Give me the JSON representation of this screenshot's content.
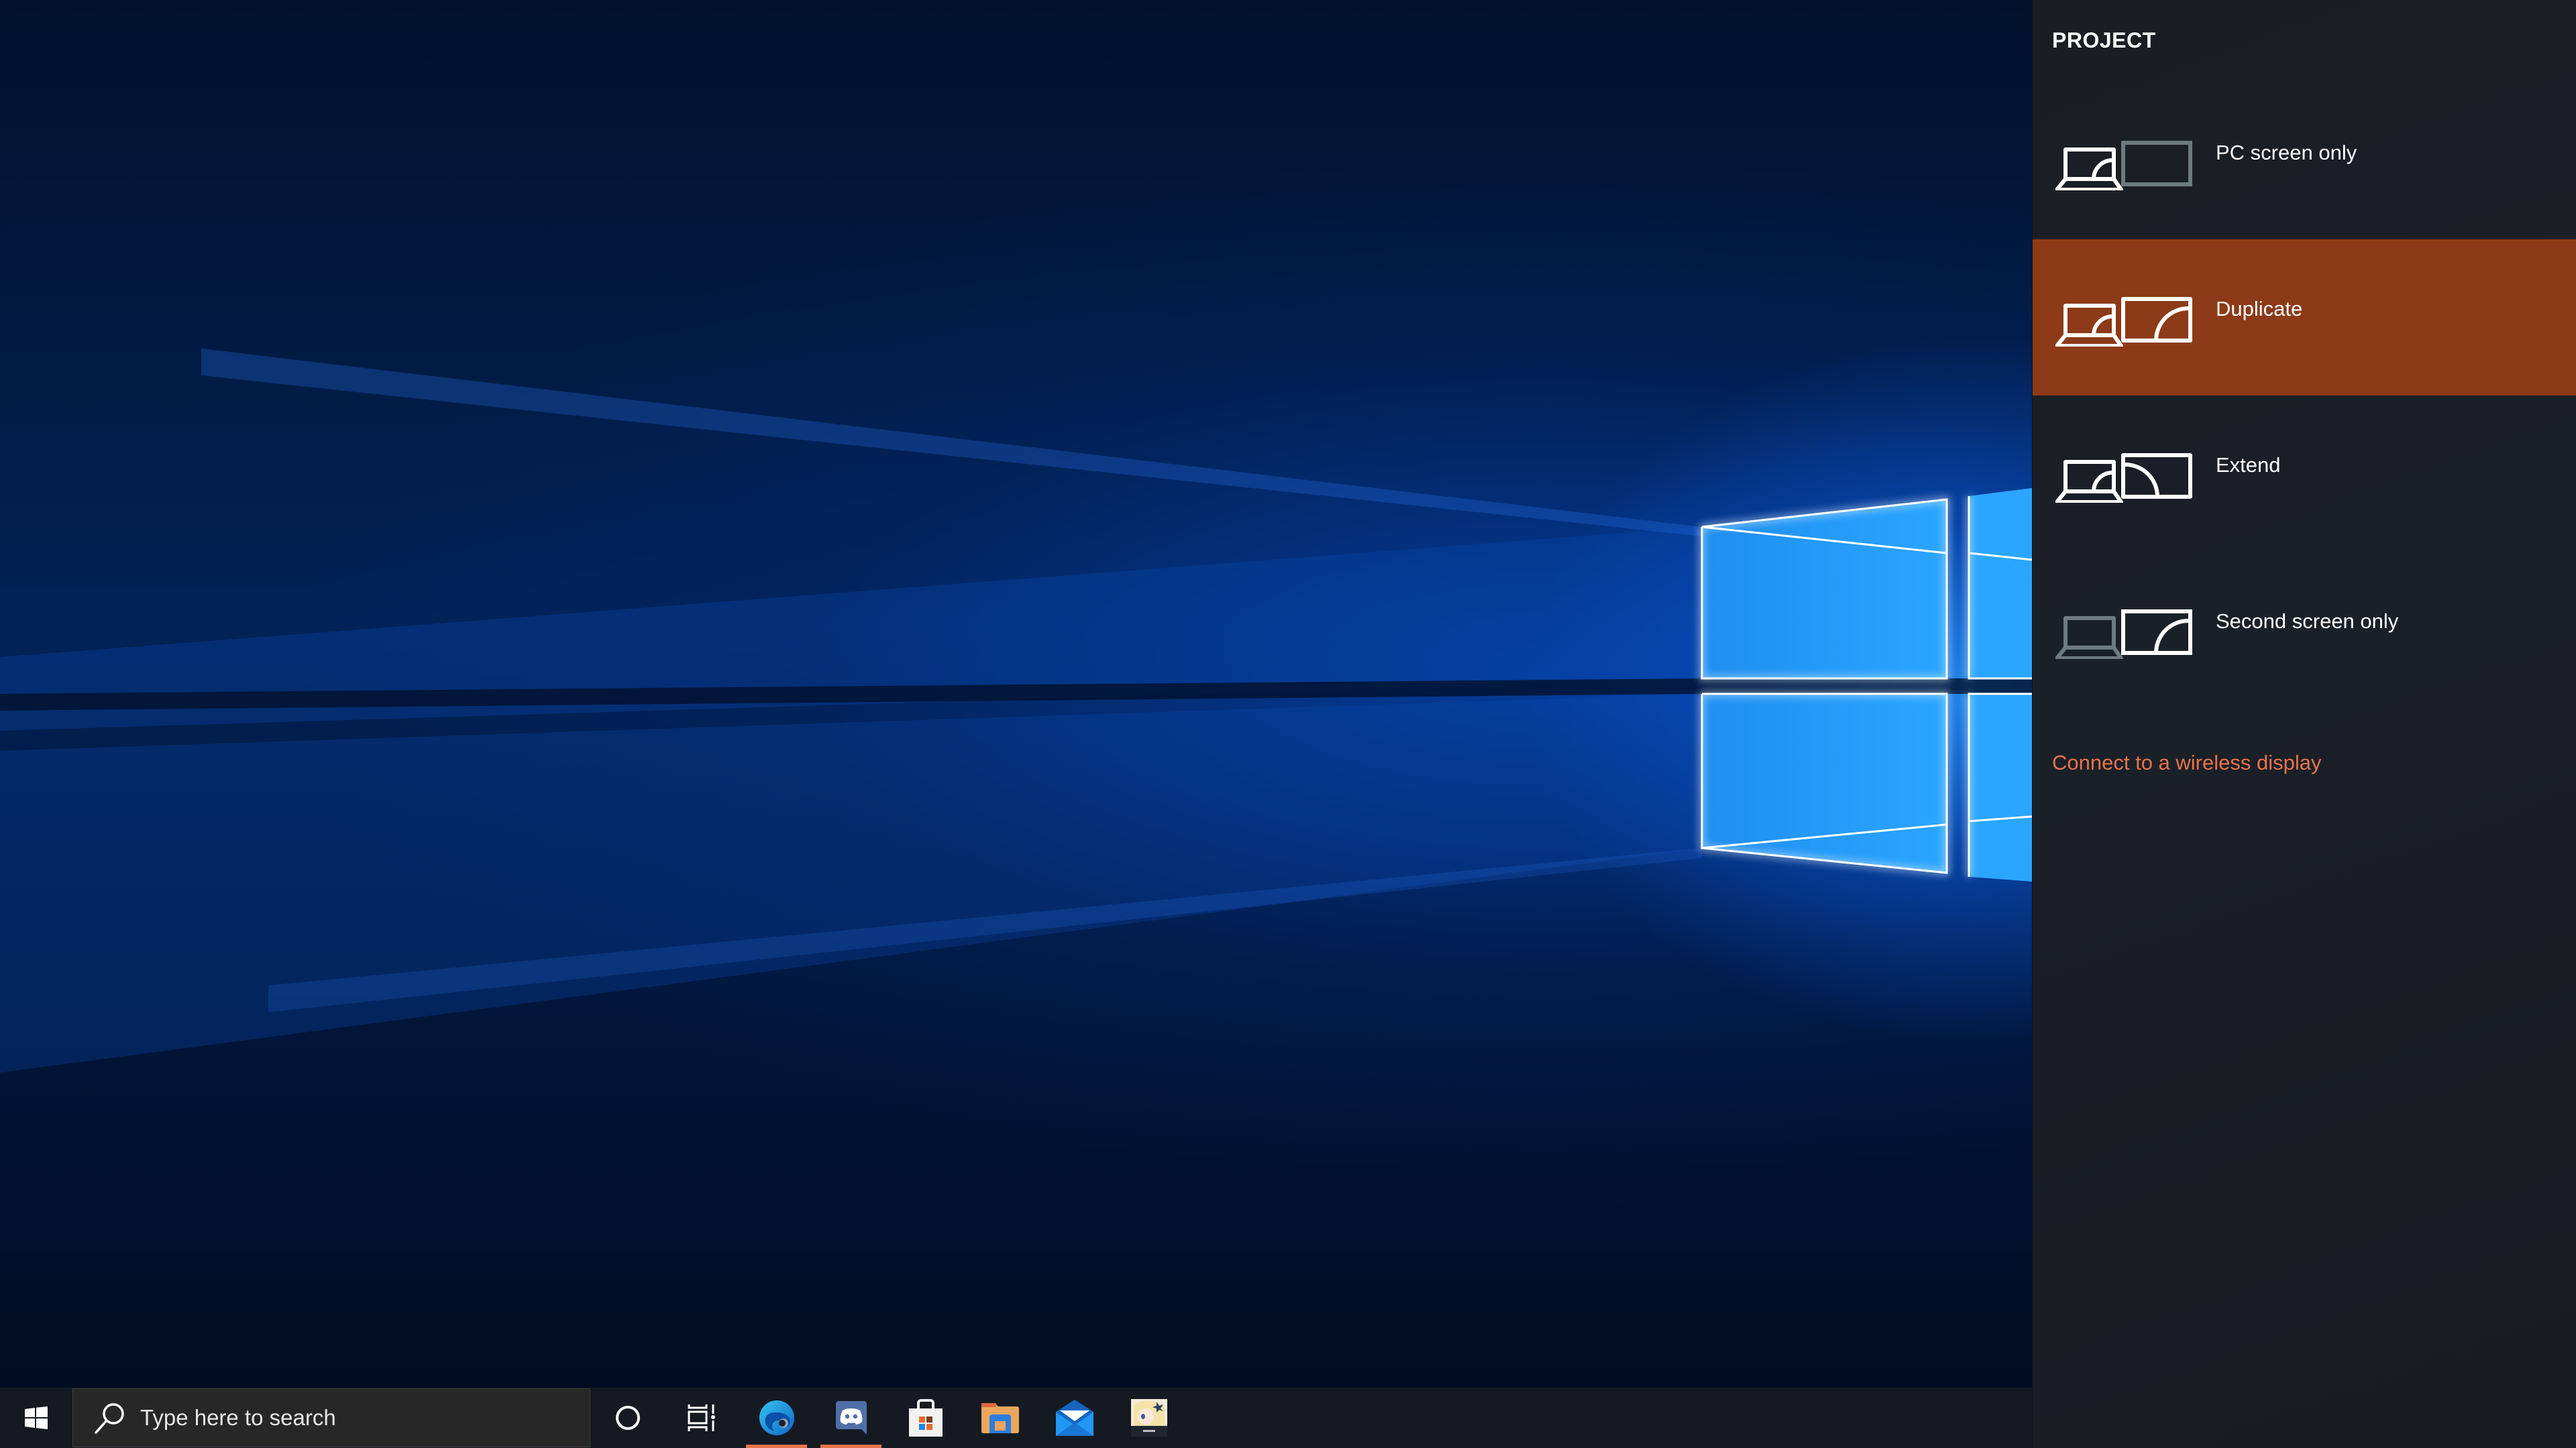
{
  "desktop": {
    "wallpaper": "Windows 10 hero wallpaper (blue light window)"
  },
  "taskbar": {
    "start_icon": "windows-logo-icon",
    "search": {
      "placeholder": "Type here to search",
      "icon": "search-icon"
    },
    "buttons": [
      {
        "name": "cortana",
        "icon": "cortana-circle-icon",
        "running": false
      },
      {
        "name": "task-view",
        "icon": "task-view-icon",
        "running": false
      },
      {
        "name": "microsoft-edge",
        "icon": "edge-icon",
        "running": true
      },
      {
        "name": "discord",
        "icon": "discord-icon",
        "running": true
      },
      {
        "name": "microsoft-store",
        "icon": "store-bag-icon",
        "running": false
      },
      {
        "name": "file-explorer",
        "icon": "folder-icon",
        "running": false
      },
      {
        "name": "mail",
        "icon": "mail-envelope-icon",
        "running": false
      },
      {
        "name": "app-shortcut",
        "icon": "anime-character-app-icon",
        "running": false
      }
    ],
    "indicator_color": "#e8734a"
  },
  "project_panel": {
    "title": "PROJECT",
    "accent_color": "#8c3a17",
    "items": [
      {
        "label": "PC screen only",
        "icon": "pc-screen-only-icon",
        "selected": false
      },
      {
        "label": "Duplicate",
        "icon": "duplicate-icon",
        "selected": true
      },
      {
        "label": "Extend",
        "icon": "extend-icon",
        "selected": false
      },
      {
        "label": "Second screen only",
        "icon": "second-screen-only-icon",
        "selected": false
      }
    ],
    "wireless_link": "Connect to a wireless display",
    "link_color": "#e8734a"
  }
}
